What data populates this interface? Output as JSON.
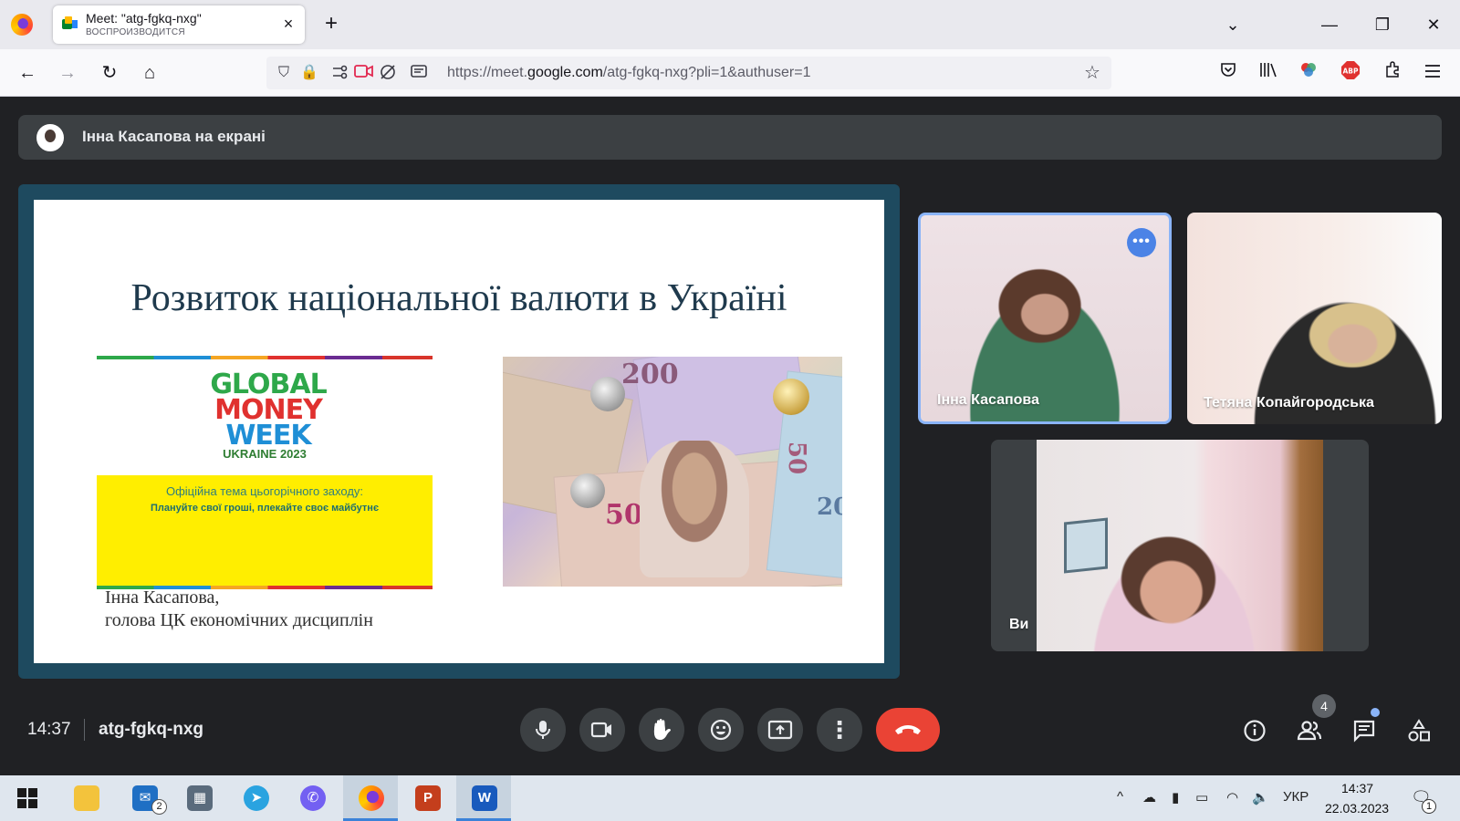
{
  "browser": {
    "tab": {
      "title": "Meet: \"atg-fgkq-nxg\"",
      "subtitle": "ВОСПРОИЗВОДИТСЯ",
      "close": "×"
    },
    "new_tab": "+",
    "window": {
      "list_tabs": "⌄",
      "minimize": "—",
      "restore": "❐",
      "close": "✕"
    },
    "nav": {
      "back": "←",
      "forward": "→",
      "reload": "↻",
      "home": "⌂"
    },
    "url": {
      "prefix": "https://meet.",
      "domain": "google.com",
      "path": "/atg-fgkq-nxg?pli=1&authuser=1"
    }
  },
  "meet": {
    "presenting_text": "Інна Касапова на екрані",
    "slide": {
      "title": "Розвиток національної валюти в Україні",
      "logo": {
        "line1": "GLOBAL",
        "line2": "MONEY",
        "line3": "WEEK",
        "country": "UKRAINE 2023"
      },
      "theme_label": "Офіційна тема цьогорічного заходу:",
      "theme_slogan": "Плануйте свої гроші, плекайте своє майбутнє",
      "author_line1": "Інна Касапова,",
      "author_line2": "голова ЦК економічних дисциплін",
      "banknote_numbers": {
        "n200": "200",
        "n50a": "50",
        "n50b": "50",
        "n20": "20"
      }
    },
    "participants": [
      {
        "name": "Інна Касапова"
      },
      {
        "name": "Тетяна Копайгородська"
      },
      {
        "name": "Ви"
      }
    ],
    "more_options": "•••",
    "time": "14:37",
    "meeting_code": "atg-fgkq-nxg",
    "people_count": "4"
  },
  "taskbar": {
    "mail_badge": "2",
    "tray_language": "УКР",
    "clock_time": "14:37",
    "clock_date": "22.03.2023",
    "notification_count": "1"
  },
  "icons": {
    "lock": "🔒",
    "shield": "⛉",
    "star": "☆",
    "mic": "🎤",
    "camera": "▭",
    "hand": "✋",
    "emoji": "☺",
    "present": "⇪",
    "more": "⋮",
    "end_call": "☎",
    "info": "ⓘ",
    "people": "👥",
    "chat": "💬",
    "activities": "△"
  },
  "colors": {
    "meet_background": "#202124",
    "end_call": "#ea4335",
    "active_tile_border": "#8ab4f8",
    "slide_frame": "#1e4a5f"
  }
}
